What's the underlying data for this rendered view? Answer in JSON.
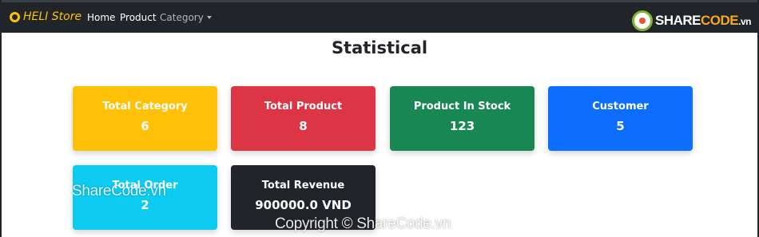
{
  "navbar": {
    "brand": "HELI Store",
    "links": {
      "home": "Home",
      "product": "Product",
      "category": "Category"
    }
  },
  "watermark": {
    "logo_share": "SHARE",
    "logo_code": "CODE",
    "logo_vn": ".vn",
    "overlay": "ShareCode.vn",
    "copyright": "Copyright © ShareCode.vn"
  },
  "page": {
    "title": "Statistical"
  },
  "cards": [
    {
      "title": "Total Category",
      "value": "6",
      "color": "#ffc107"
    },
    {
      "title": "Total Product",
      "value": "8",
      "color": "#dc3545"
    },
    {
      "title": "Product In Stock",
      "value": "123",
      "color": "#198754"
    },
    {
      "title": "Customer",
      "value": "5",
      "color": "#0d6efd"
    },
    {
      "title": "Total Order",
      "value": "2",
      "color": "#0dcaf0"
    },
    {
      "title": "Total Revenue",
      "value": "900000.0 VND",
      "color": "#212529"
    }
  ]
}
